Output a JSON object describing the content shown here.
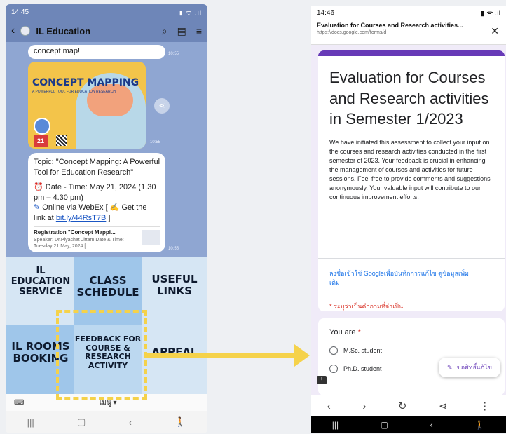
{
  "left_phone": {
    "status": {
      "time": "14:45",
      "right": "▮ ᯤ .ıl"
    },
    "header": {
      "title": "IL Education"
    },
    "chat": {
      "top_bubble": "concept map!",
      "top_time": "10:55",
      "poster": {
        "title": "CONCEPT MAPPING",
        "subtitle": "A POWERFUL TOOL FOR EDUCATION RESEARCH",
        "date": "21"
      },
      "poster_time": "10:55",
      "message": {
        "topic": "Topic: \"Concept Mapping: A Powerful Tool for Education Research\"",
        "datetime": "Date - Time: May 21, 2024 (1.30 pm – 4.30 pm)",
        "online_prefix": "Online via WebEx [",
        "online_suffix": "Get the link at",
        "link": "bit.ly/44RsT7B",
        "link_end": "]",
        "preview_title": "Registration \"Concept Mappi...",
        "preview_sub": "Speaker: Dr.Piyachat Jittam Date & Time: Tuesday 21 May, 2024 [..."
      },
      "message_time": "10:55"
    },
    "menu": {
      "cell1": "IL EDUCATION SERVICE",
      "cell2": "CLASS SCHEDULE",
      "cell3": "USEFUL LINKS",
      "cell4": "IL ROOMS BOOKING",
      "cell5": "FEEDBACK FOR COURSE & RESEARCH ACTIVITY",
      "cell6": "APPEAL"
    },
    "bottom_label": "เมนู ▾",
    "nav": [
      "|||",
      "▢",
      "‹",
      "🚶"
    ]
  },
  "right_phone": {
    "status": {
      "time": "14:46",
      "right": "▮ ᯤ .ıl"
    },
    "urlbar": {
      "title": "Evaluation for Courses and Research activities...",
      "url": "https://docs.google.com/forms/d"
    },
    "form": {
      "title": "Evaluation for Courses and Research activities in Semester 1/2023",
      "description": "We have initiated this assessment to collect your input on the courses and research activities conducted in the first semester of 2023. Your feedback is crucial in enhancing the management of courses and activities for future sessions. Feel free to provide comments and suggestions anonymously. Your valuable input will contribute to our continuous improvement efforts.",
      "signin": "ลงชื่อเข้าใช้ Googleเพื่อบันทึกการแก้ไข ดูข้อมูลเพิ่มเติม",
      "required_note": "* ระบุว่าเป็นคำถามที่จำเป็น"
    },
    "question": {
      "title": "You are",
      "options": [
        "M.Sc. student",
        "Ph.D. student"
      ]
    },
    "fab_label": "ขอสิทธิ์แก้ไข",
    "browser": [
      "‹",
      "›",
      "↻",
      "⋖",
      "⋮"
    ],
    "nav": [
      "|||",
      "▢",
      "‹",
      "🚶"
    ]
  }
}
